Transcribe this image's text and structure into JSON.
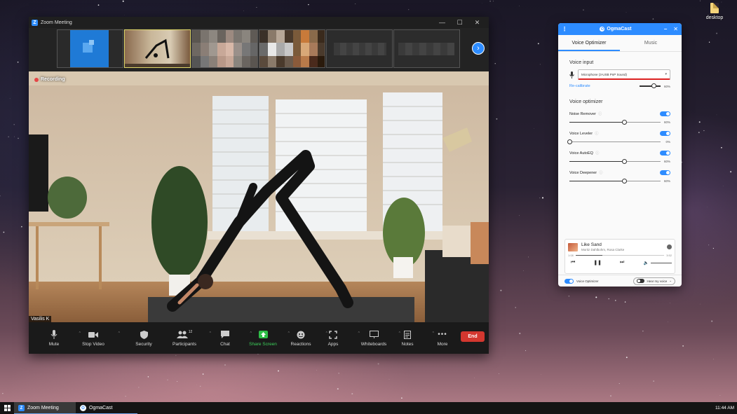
{
  "desktop": {
    "icon_label": "desktop"
  },
  "zoom": {
    "window_title": "Zoom Meeting",
    "recording_label": "Recording",
    "participant_name": "Vasilis K",
    "toolbar": {
      "mute": "Mute",
      "stop_video": "Stop Video",
      "security": "Security",
      "participants": "Participants",
      "participants_count": "12",
      "chat": "Chat",
      "share_screen": "Share Screen",
      "reactions": "Reactions",
      "apps": "Apps",
      "whiteboards": "Whiteboards",
      "notes": "Notes",
      "more": "More",
      "end": "End"
    }
  },
  "ogmacast": {
    "title": "OgmaCast",
    "tabs": [
      "Voice Optimizer",
      "Music"
    ],
    "voice_input_heading": "Voice input",
    "mic_device": "Microphone (3-USB PnP Sound)",
    "recalibrate": "Re-calibrate",
    "input_level": "60%",
    "input_level_value": 0.8,
    "optimizer_heading": "Voice optimizer",
    "options": [
      {
        "label": "Noise Remover",
        "value": "60%",
        "level": 0.6,
        "enabled": true
      },
      {
        "label": "Voice Leveler",
        "value": "0%",
        "level": 0.0,
        "enabled": true
      },
      {
        "label": "Voice AutoEQ",
        "value": "60%",
        "level": 0.6,
        "enabled": true
      },
      {
        "label": "Voice Deepener",
        "value": "60%",
        "level": 0.6,
        "enabled": true
      }
    ],
    "player": {
      "song": "Like Sand",
      "artist": "Moritz Dahlbohm, Rosa Clarke",
      "elapsed": "1:08",
      "duration": "3:52",
      "progress": 0.3
    },
    "footer": {
      "voice_optimizer": "Voice Optimizer",
      "hear_my_voice": "Hear my voice"
    }
  },
  "taskbar": {
    "items": [
      "Zoom Meeting",
      "OgmaCast"
    ],
    "clock": "11:44 AM"
  }
}
